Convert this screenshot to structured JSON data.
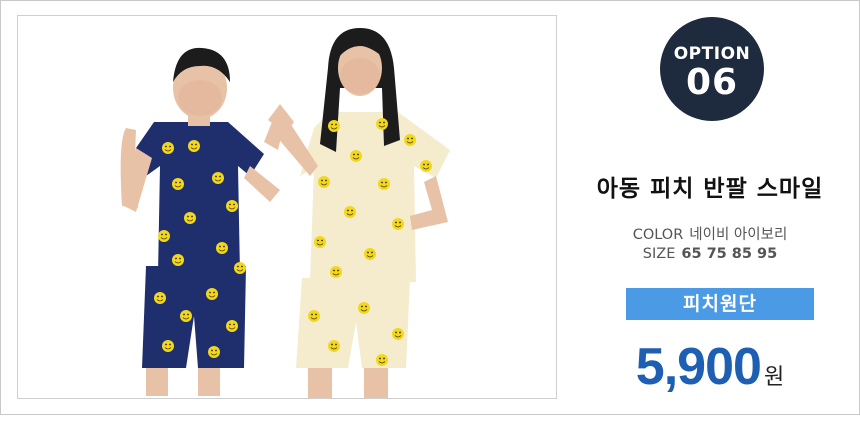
{
  "badge": {
    "option_label": "OPTION",
    "option_number": "06"
  },
  "product": {
    "name": "아동 피치 반팔 스마일"
  },
  "specs": {
    "color_label": "COLOR",
    "color_value": "네이비 아이보리",
    "size_label": "SIZE",
    "size_value": "65 75 85 95"
  },
  "fabric_label": "피치원단",
  "price": {
    "amount": "5,900",
    "unit": "원"
  },
  "colors": {
    "badge_bg": "#1e2a3d",
    "band_bg": "#4a9ae6",
    "price": "#1d5fb3",
    "navy_outfit": "#1f2f6e",
    "ivory_outfit": "#f4eccc",
    "smiley": "#f2d81c"
  },
  "photo": {
    "subject": "two children wearing smiley-print short-sleeve pajama sets, navy and ivory"
  }
}
